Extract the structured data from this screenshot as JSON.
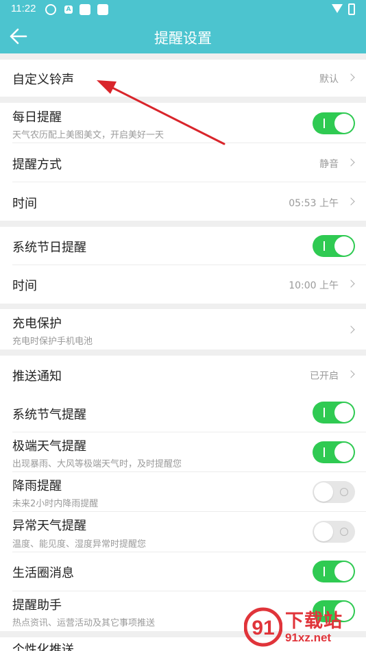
{
  "status_bar": {
    "time": "11:22",
    "icon_a": "A"
  },
  "header": {
    "title": "提醒设置"
  },
  "sections": {
    "ringtone": {
      "label": "自定义铃声",
      "value": "默认"
    },
    "daily": {
      "label": "每日提醒",
      "sub": "天气农历配上美图美文，开启美好一天",
      "toggle": "on"
    },
    "method": {
      "label": "提醒方式",
      "value": "静音"
    },
    "daily_time": {
      "label": "时间",
      "value": "05:53 上午"
    },
    "holiday": {
      "label": "系统节日提醒",
      "toggle": "on"
    },
    "holiday_time": {
      "label": "时间",
      "value": "10:00 上午"
    },
    "charge": {
      "label": "充电保护",
      "sub": "充电时保护手机电池"
    },
    "push": {
      "label": "推送通知",
      "value": "已开启"
    },
    "solar_term": {
      "label": "系统节气提醒",
      "toggle": "on"
    },
    "extreme": {
      "label": "极端天气提醒",
      "sub": "出现暴雨、大风等极端天气时，及时提醒您",
      "toggle": "on"
    },
    "rain": {
      "label": "降雨提醒",
      "sub": "未来2小时内降雨提醒",
      "toggle": "off"
    },
    "abnormal": {
      "label": "异常天气提醒",
      "sub": "温度、能见度、湿度异常时提醒您",
      "toggle": "off"
    },
    "circle": {
      "label": "生活圈消息",
      "toggle": "on"
    },
    "assistant": {
      "label": "提醒助手",
      "sub": "热点资讯、运营活动及其它事项推送",
      "toggle": "on"
    },
    "personal": {
      "label": "个性化推送"
    }
  },
  "watermark": {
    "text": "下载站",
    "url": "91xz.net"
  },
  "colors": {
    "header": "#4cc4cf",
    "toggle_on": "#2fca52",
    "arrow": "#d9252b"
  }
}
